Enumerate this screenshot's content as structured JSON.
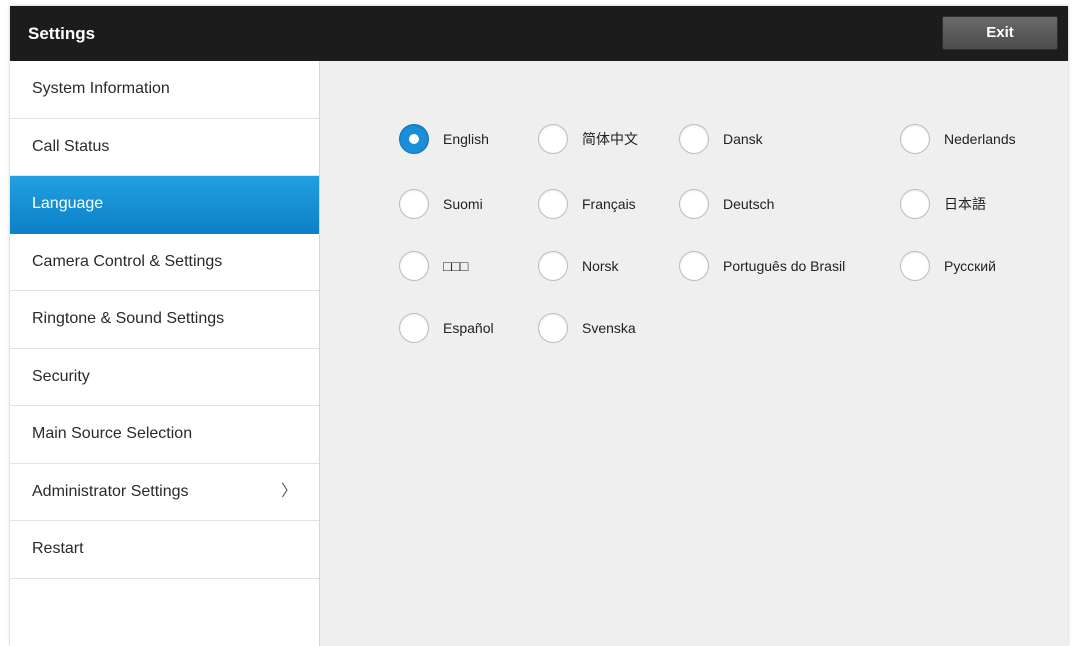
{
  "app": {
    "title": "Settings",
    "exit_label": "Exit"
  },
  "sidebar": {
    "items": [
      {
        "label": "System Information"
      },
      {
        "label": "Call Status"
      },
      {
        "label": "Language"
      },
      {
        "label": "Camera Control & Settings"
      },
      {
        "label": "Ringtone & Sound Settings"
      },
      {
        "label": "Security"
      },
      {
        "label": "Main Source Selection"
      },
      {
        "label": "Administrator Settings",
        "chevron": "〉"
      },
      {
        "label": "Restart"
      }
    ],
    "active_item": "Language"
  },
  "languages": {
    "selected": "English",
    "options": [
      {
        "label": "English"
      },
      {
        "label": "简体中文"
      },
      {
        "label": "Dansk"
      },
      {
        "label": "Nederlands"
      },
      {
        "label": "Suomi"
      },
      {
        "label": "Français"
      },
      {
        "label": "Deutsch"
      },
      {
        "label": "日本語"
      },
      {
        "label": "□□□"
      },
      {
        "label": "Norsk"
      },
      {
        "label": "Português do Brasil"
      },
      {
        "label": "Русский"
      },
      {
        "label": "Español"
      },
      {
        "label": "Svenska"
      }
    ]
  },
  "colors": {
    "titlebar": "#1c1c1c",
    "accent": "#1a8fd8",
    "content_bg": "#efefef"
  }
}
